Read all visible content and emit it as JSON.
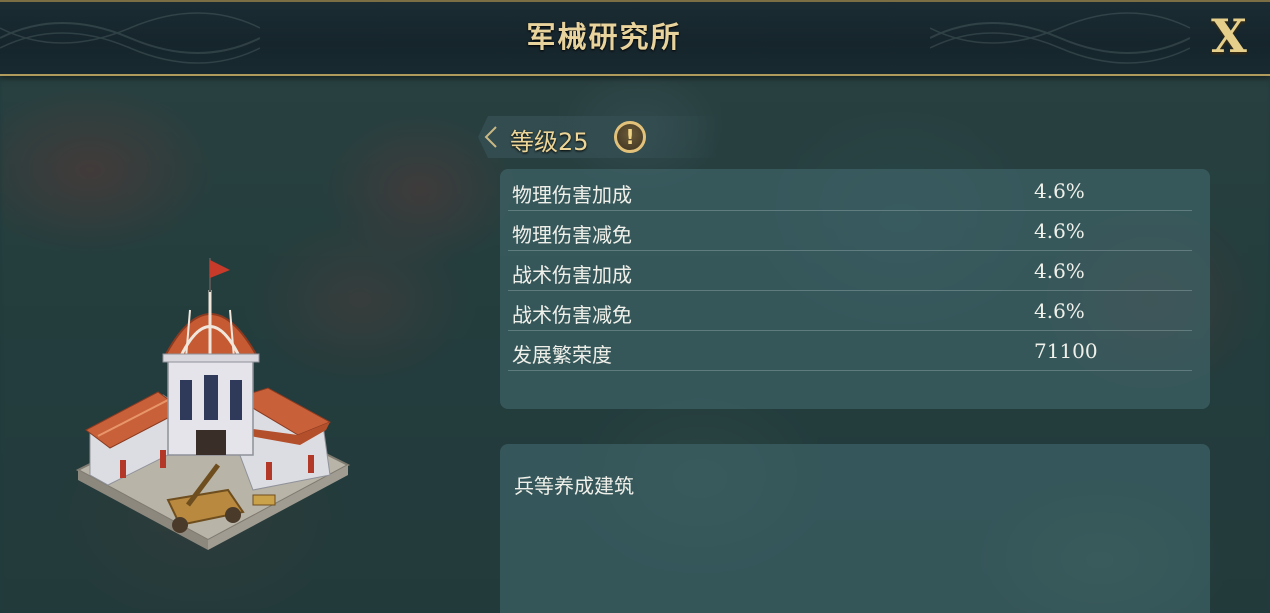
{
  "header": {
    "title": "军械研究所",
    "close_label": "X"
  },
  "level": {
    "label": "等级25",
    "info_glyph": "!"
  },
  "stats": [
    {
      "label": "物理伤害加成",
      "value": "4.6%"
    },
    {
      "label": "物理伤害减免",
      "value": "4.6%"
    },
    {
      "label": "战术伤害加成",
      "value": "4.6%"
    },
    {
      "label": "战术伤害减免",
      "value": "4.6%"
    },
    {
      "label": "发展繁荣度",
      "value": "71100"
    }
  ],
  "description": {
    "text": "兵等养成建筑"
  },
  "colors": {
    "gold_accent": "#e8d39c",
    "panel_bg": "#466e73",
    "header_bg": "#16252c"
  }
}
